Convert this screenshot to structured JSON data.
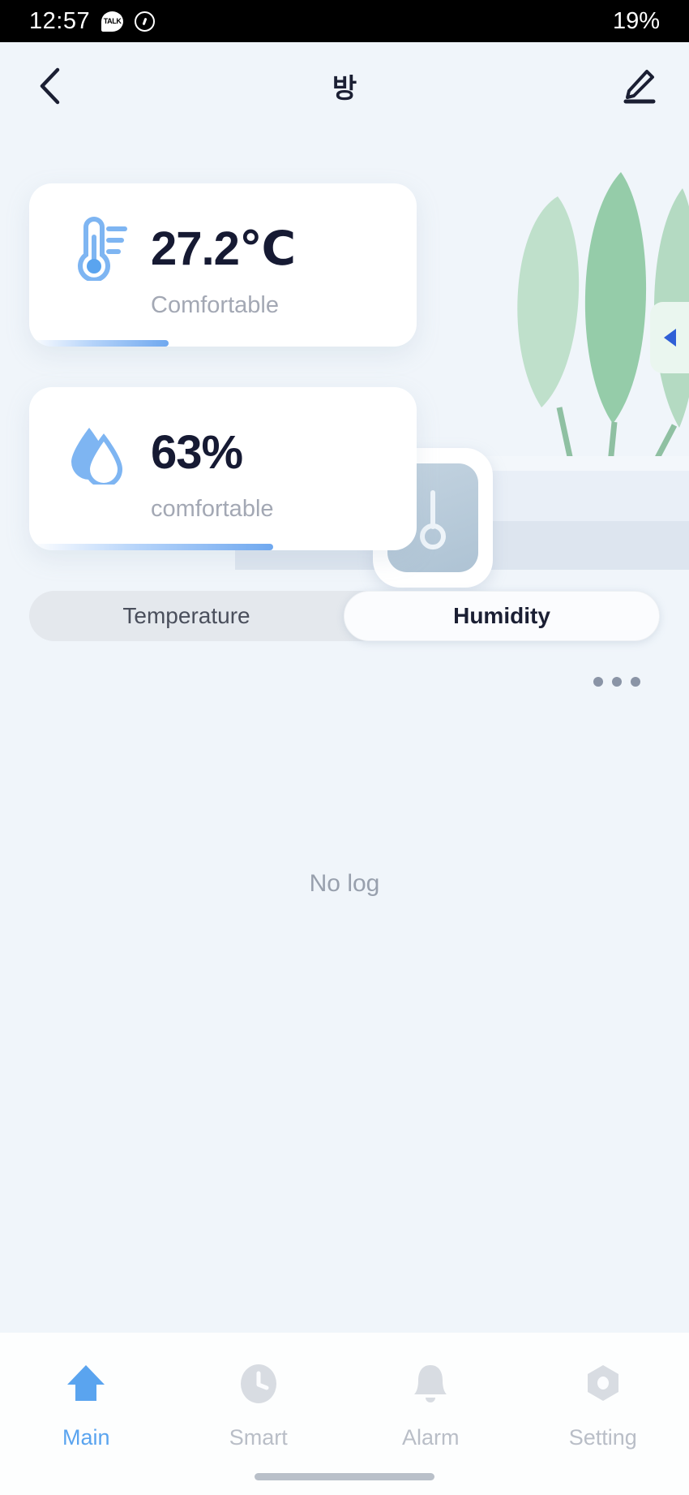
{
  "status_bar": {
    "time": "12:57",
    "kakao_label": "TALK",
    "kakao_icon": "kakaotalk-icon",
    "sync_icon": "sync-rotate-icon",
    "battery": "19%"
  },
  "header": {
    "back_icon": "back-chevron-icon",
    "title": "방",
    "edit_icon": "pencil-edit-icon"
  },
  "illustration": {
    "sensor_icon": "thermometer-device-icon",
    "plant_icon": "potted-plant-icon",
    "side_tab_icon": "left-triangle-icon"
  },
  "cards": [
    {
      "name": "temperature",
      "icon": "thermometer-icon",
      "value": "27.2℃",
      "status": "Comfortable",
      "progress": 36
    },
    {
      "name": "humidity",
      "icon": "water-drop-icon",
      "value": "63%",
      "status": "comfortable",
      "progress": 63
    }
  ],
  "segmented": {
    "options": [
      {
        "label": "Temperature",
        "active": false
      },
      {
        "label": "Humidity",
        "active": true
      }
    ]
  },
  "menu": {
    "icon": "three-dots-icon"
  },
  "log": {
    "empty_text": "No log"
  },
  "bottom_nav": [
    {
      "label": "Main",
      "icon": "home-icon",
      "active": true
    },
    {
      "label": "Smart",
      "icon": "clock-icon",
      "active": false
    },
    {
      "label": "Alarm",
      "icon": "bell-icon",
      "active": false
    },
    {
      "label": "Setting",
      "icon": "gear-hexagon-icon",
      "active": false
    }
  ],
  "colors": {
    "accent": "#5aa4ef",
    "background": "#f0f5fa",
    "text_dark": "#161a33",
    "text_muted": "#a3a8b4"
  }
}
